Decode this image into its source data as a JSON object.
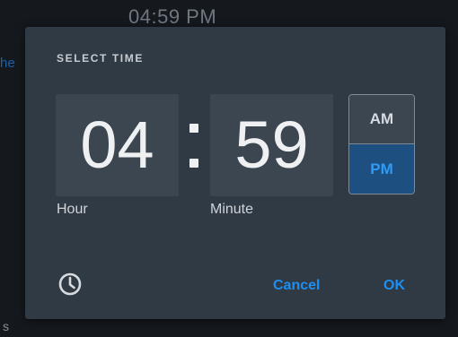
{
  "background": {
    "time": "04:59 PM",
    "left_fragment": "he",
    "bottom_fragment": "s"
  },
  "dialog": {
    "title": "SELECT TIME",
    "hour": "04",
    "minute": "59",
    "separator": ":",
    "hour_label": "Hour",
    "minute_label": "Minute",
    "am_label": "AM",
    "pm_label": "PM",
    "selected_period": "PM",
    "icon": "clock-icon",
    "cancel_label": "Cancel",
    "ok_label": "OK"
  },
  "colors": {
    "dialog_background": "#303a45",
    "field_background": "#3b4651",
    "accent": "#1f8fef",
    "selected_background": "#1d4f80"
  }
}
